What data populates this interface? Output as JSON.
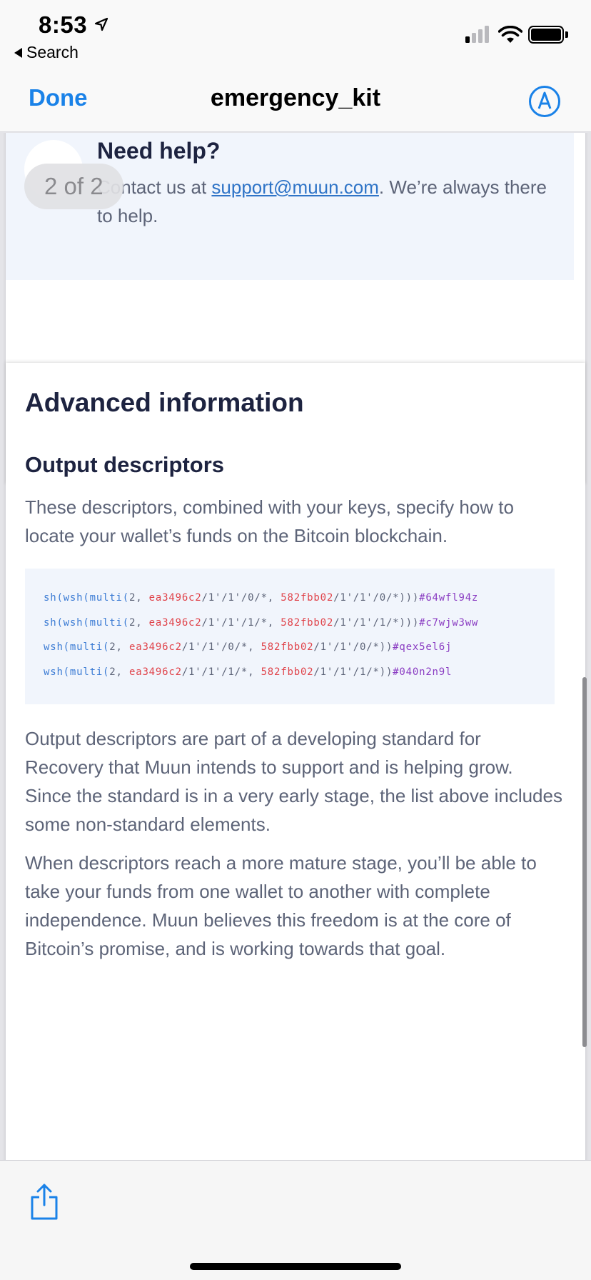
{
  "status_bar": {
    "time": "8:53",
    "back_label": "Search"
  },
  "nav": {
    "done_label": "Done",
    "title": "emergency_kit",
    "markup_icon": "markup-pen-circle-icon"
  },
  "page_indicator": "2 of 2",
  "help": {
    "title": "Need help?",
    "text_before": "Contact us at ",
    "email": "support@muun.com",
    "text_after": ". We’re always there to help."
  },
  "advanced": {
    "title": "Advanced information",
    "subtitle": "Output descriptors",
    "intro": "These descriptors, combined with your keys, specify how to locate your wallet’s funds on the Bitcoin blockchain.",
    "descriptors": [
      {
        "prefix": "sh(wsh(multi(",
        "threshold": "2, ",
        "key1": "ea3496c2",
        "path1": "/1'/1'/0/*, ",
        "key2": "582fbb02",
        "path2": "/1'/1'/0/*)))",
        "checksum": "#64wfl94z"
      },
      {
        "prefix": "sh(wsh(multi(",
        "threshold": "2, ",
        "key1": "ea3496c2",
        "path1": "/1'/1'/1/*, ",
        "key2": "582fbb02",
        "path2": "/1'/1'/1/*)))",
        "checksum": "#c7wjw3ww"
      },
      {
        "prefix": "wsh(multi(",
        "threshold": "2, ",
        "key1": "ea3496c2",
        "path1": "/1'/1'/0/*, ",
        "key2": "582fbb02",
        "path2": "/1'/1'/0/*))",
        "checksum": "#qex5el6j"
      },
      {
        "prefix": "wsh(multi(",
        "threshold": "2, ",
        "key1": "ea3496c2",
        "path1": "/1'/1'/1/*, ",
        "key2": "582fbb02",
        "path2": "/1'/1'/1/*))",
        "checksum": "#040n2n9l"
      }
    ],
    "para2": "Output descriptors are part of a developing standard for Recovery that Muun intends to support and is helping grow. Since the standard is in a very early stage, the list above includes some non-standard elements.",
    "para3": "When descriptors reach a more mature stage, you’ll be able to take your funds from one wallet to another with complete independence. Muun believes this freedom is at the core of Bitcoin’s promise, and is working towards that goal."
  },
  "colors": {
    "accent": "#1a82e8",
    "heading": "#1d2340",
    "body": "#5d6478",
    "code_fn": "#3b7bd4",
    "code_key": "#e0434a",
    "code_checksum": "#8a3cc2"
  },
  "toolbar": {
    "share_icon": "share-icon"
  }
}
